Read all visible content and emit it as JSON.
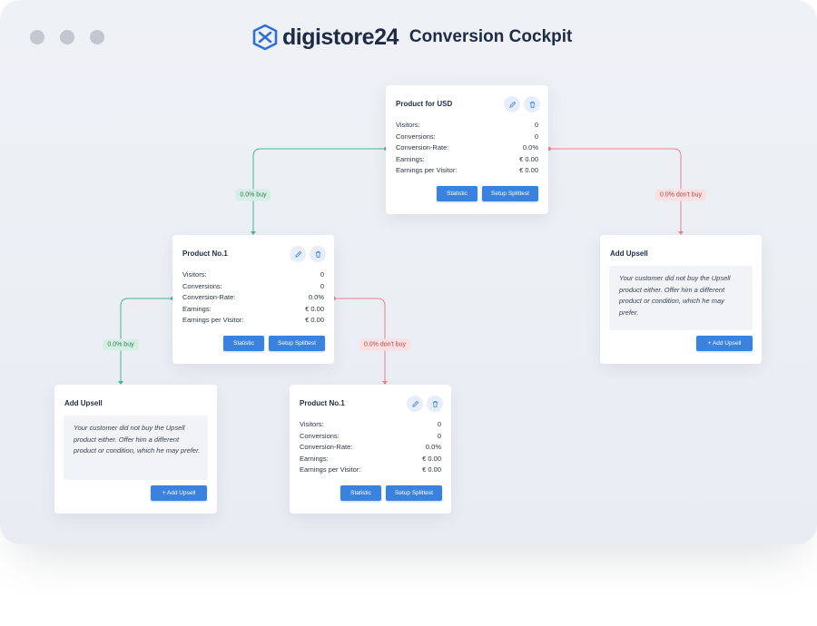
{
  "window": {
    "controls": [
      "close",
      "minimize",
      "maximize"
    ],
    "brand": "digistore24",
    "title": "Conversion Cockpit"
  },
  "edges": {
    "buy_label": "0.0% buy",
    "dont_buy_label": "0.0% don't buy",
    "buy_color": "#44b88c",
    "dont_buy_color": "#e8858c"
  },
  "labels": {
    "visitors": "Visitors:",
    "conversions": "Conversions:",
    "conversion_rate": "Conversion-Rate:",
    "earnings": "Earnings:",
    "earnings_per_visitor": "Earnings per Visitor:",
    "statistic": "Statistic",
    "setup_splittest": "Setup Splittest",
    "add_upsell_title": "Add Upsell",
    "add_upsell_button": "+ Add Upsell",
    "upsell_hint": "Your customer did not buy the Upsell product either. Offer him a different product or condition, which he may prefer."
  },
  "nodes": {
    "root": {
      "title": "Product for USD",
      "visitors": "0",
      "conversions": "0",
      "conversion_rate": "0.0%",
      "earnings": "€  0.00",
      "earnings_per_visitor": "€  0.00"
    },
    "mid": {
      "title": "Product No.1",
      "visitors": "0",
      "conversions": "0",
      "conversion_rate": "0.0%",
      "earnings": "€  0.00",
      "earnings_per_visitor": "€  0.00"
    },
    "leaf": {
      "title": "Product No.1",
      "visitors": "0",
      "conversions": "0",
      "conversion_rate": "0.0%",
      "earnings": "€  0.00",
      "earnings_per_visitor": "€  0.00"
    }
  },
  "colors": {
    "accent": "#3a82de",
    "title": "#1f2a44"
  },
  "icons": {
    "edit": "pencil-icon",
    "delete": "trash-icon"
  }
}
